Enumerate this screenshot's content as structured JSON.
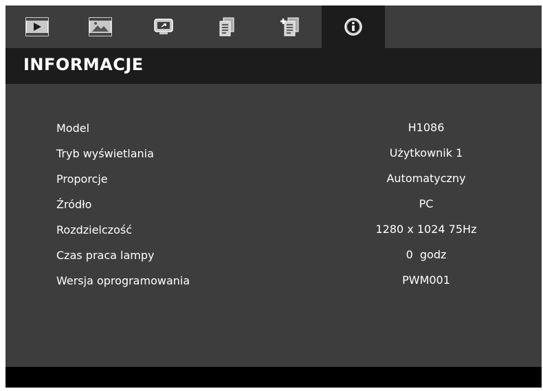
{
  "tabs": [
    {
      "icon": "play-icon",
      "label": ""
    },
    {
      "icon": "picture-icon",
      "label": ""
    },
    {
      "icon": "display-icon",
      "label": ""
    },
    {
      "icon": "document-icon",
      "label": ""
    },
    {
      "icon": "document-plus-icon",
      "label": ""
    },
    {
      "icon": "info-icon",
      "label": ""
    }
  ],
  "header": {
    "title": "INFORMACJE"
  },
  "info": {
    "rows": [
      {
        "label": "Model",
        "value": "H1086"
      },
      {
        "label": "Tryb wyświetlania",
        "value": "Użytkownik 1"
      },
      {
        "label": "Proporcje",
        "value": "Automatyczny"
      },
      {
        "label": "Źródło",
        "value": "PC"
      },
      {
        "label": "Rozdzielczość",
        "value": "1280 x 1024 75Hz"
      },
      {
        "label": "Czas praca lampy",
        "value": "0  godz"
      },
      {
        "label": "Wersja oprogramowania",
        "value": "PWM001"
      }
    ]
  },
  "colors": {
    "panel": "#3d3d3d",
    "header": "#1c1c1c",
    "footer": "#000000",
    "text": "#ffffff"
  }
}
